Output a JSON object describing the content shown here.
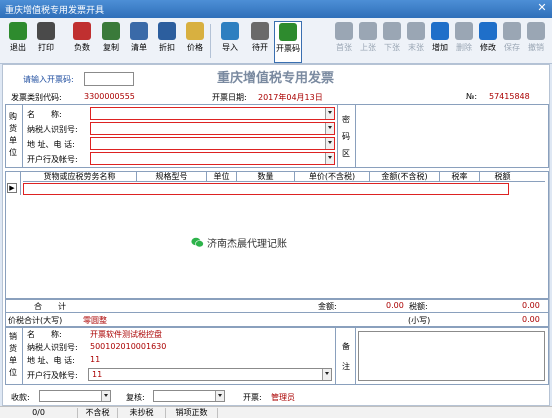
{
  "window": {
    "title": "重庆增值税专用发票开具",
    "close_glyph": "✕"
  },
  "toolbar": {
    "buttons": [
      {
        "name": "exit-button",
        "label": "退出",
        "icon": "exit-door-icon",
        "color": "#2e8b2e",
        "enabled": true
      },
      {
        "name": "print-button",
        "label": "打印",
        "icon": "printer-icon",
        "color": "#4a4a4a",
        "enabled": true
      },
      {
        "name": "negative-button",
        "label": "负数",
        "icon": "negative-invoice-icon",
        "color": "#c03030",
        "enabled": true
      },
      {
        "name": "copy-button",
        "label": "复制",
        "icon": "copy-icon",
        "color": "#3a7a3a",
        "enabled": true
      },
      {
        "name": "clear-button",
        "label": "清单",
        "icon": "list-icon",
        "color": "#3a6aa8",
        "enabled": true
      },
      {
        "name": "discount-button",
        "label": "折扣",
        "icon": "discount-icon",
        "color": "#2c5e9e",
        "enabled": true
      },
      {
        "name": "price-button",
        "label": "价格",
        "icon": "price-tag-icon",
        "color": "#d8b040",
        "enabled": true
      },
      {
        "name": "import-button",
        "label": "导入",
        "icon": "import-icon",
        "color": "#2e7fc0",
        "enabled": true
      },
      {
        "name": "pending-button",
        "label": "待开",
        "icon": "pending-icon",
        "color": "#6a6a6a",
        "enabled": true
      },
      {
        "name": "invoice-code-button",
        "label": "开票码",
        "icon": "invoice-code-icon",
        "color": "#2e8b2e",
        "enabled": true
      },
      {
        "name": "first-button",
        "label": "首张",
        "icon": "first-record-icon",
        "color": "#9aa6b4",
        "enabled": false
      },
      {
        "name": "prev-button",
        "label": "上张",
        "icon": "prev-record-icon",
        "color": "#9aa6b4",
        "enabled": false
      },
      {
        "name": "next-button",
        "label": "下张",
        "icon": "next-record-icon",
        "color": "#9aa6b4",
        "enabled": false
      },
      {
        "name": "last-button",
        "label": "末张",
        "icon": "last-record-icon",
        "color": "#9aa6b4",
        "enabled": false
      },
      {
        "name": "add-button",
        "label": "增加",
        "icon": "plus-icon",
        "color": "#1f6fc9",
        "enabled": true
      },
      {
        "name": "delete-button",
        "label": "删除",
        "icon": "minus-icon",
        "color": "#9aa6b4",
        "enabled": false
      },
      {
        "name": "modify-button",
        "label": "修改",
        "icon": "modify-icon",
        "color": "#1f6fc9",
        "enabled": true
      },
      {
        "name": "save-button",
        "label": "保存",
        "icon": "check-icon",
        "color": "#9aa6b4",
        "enabled": false
      },
      {
        "name": "undo-button",
        "label": "撤销",
        "icon": "undo-icon",
        "color": "#9aa6b4",
        "enabled": false
      }
    ]
  },
  "invoice": {
    "title": "重庆增值税专用发票",
    "code_prompt": "请输入开票码:",
    "code_value": "",
    "type_code_label": "发票类别代码:",
    "type_code_value": "3300000555",
    "date_label": "开票日期:",
    "date_value": "2017年04月13日",
    "no_label": "№:",
    "no_value": "57415848"
  },
  "buyer": {
    "side_label": "购货单位",
    "name_label": "名　　称:",
    "tax_id_label": "纳税人识别号:",
    "address_label": "地 址、电 话:",
    "bank_label": "开户行及帐号:"
  },
  "password_zone": {
    "label": "密码区"
  },
  "items_table": {
    "columns": [
      "货物或应税劳务名称",
      "规格型号",
      "单位",
      "数量",
      "单价(不含税)",
      "金额(不含税)",
      "税率",
      "税额"
    ]
  },
  "watermark": {
    "text": "济南杰晨代理记账",
    "icon": "wechat-icon"
  },
  "totals": {
    "total_label": "合　　计",
    "amount_label": "金额:",
    "amount_value": "0.00",
    "tax_label": "税额:",
    "tax_value": "0.00",
    "price_tax_label": "价税合计(大写)",
    "uppercase_value": "零圆整",
    "small_label": "(小写)",
    "small_value": "0.00"
  },
  "seller": {
    "side_label": "销货单位",
    "name_label": "名　　称:",
    "name_value": "开票软件测试税控盘",
    "tax_id_label": "纳税人识别号:",
    "tax_id_value": "500102010001630",
    "address_label": "地 址、电 话:",
    "address_value": "11",
    "bank_label": "开户行及帐号:",
    "bank_value": "11",
    "remark_label": "备注"
  },
  "footer": {
    "payee_label": "收款:",
    "reviewer_label": "复核:",
    "issuer_label": "开票:",
    "issuer_value": "管理员"
  },
  "status": {
    "count": "0/0",
    "tax_mode": "不含税",
    "copy_tax": "未抄税",
    "sale_type": "销项正数"
  }
}
